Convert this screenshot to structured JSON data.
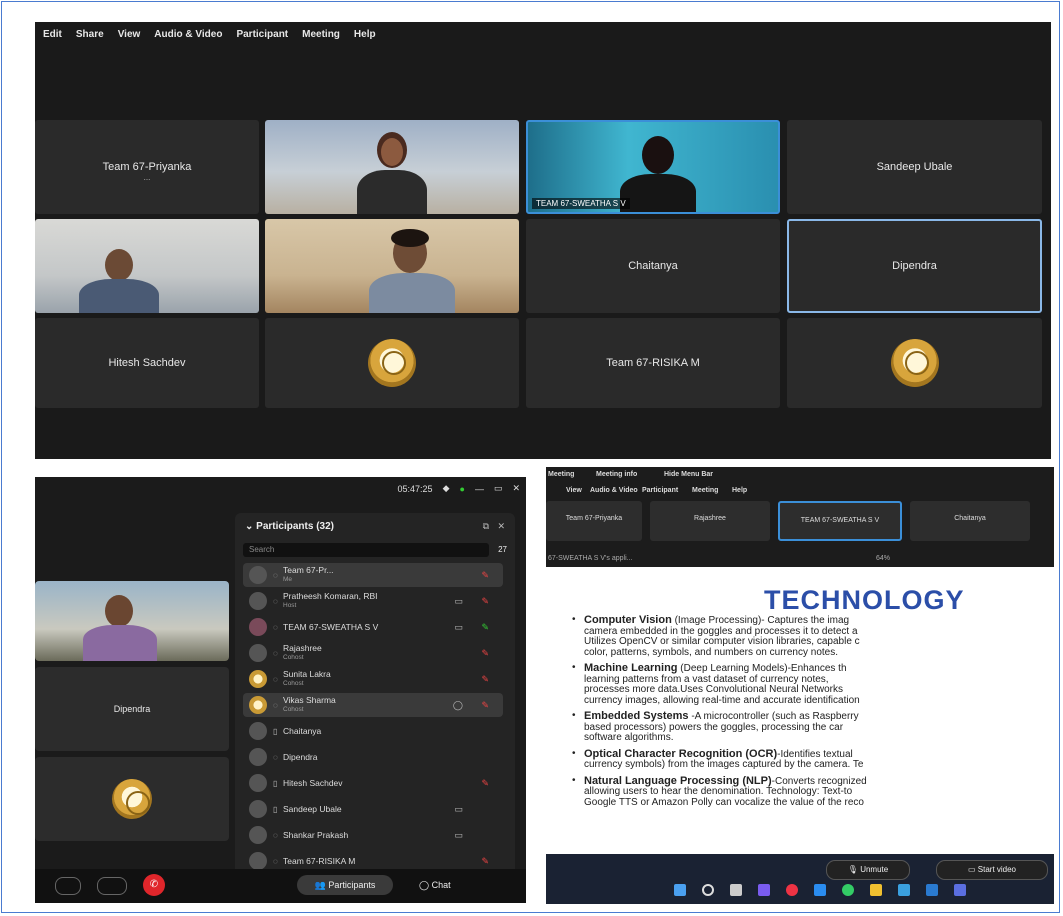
{
  "top": {
    "menu": [
      "Edit",
      "Share",
      "View",
      "Audio & Video",
      "Participant",
      "Meeting",
      "Help"
    ],
    "tiles": {
      "priyanka": {
        "name": "Team 67-Priyanka",
        "sub": "..."
      },
      "swatha": {
        "label": "TEAM 67-SWEATHA S V"
      },
      "sandeep": {
        "name": "Sandeep Ubale"
      },
      "chaitanya": {
        "name": "Chaitanya"
      },
      "dipendra": {
        "name": "Dipendra"
      },
      "hitesh": {
        "name": "Hitesh Sachdev"
      },
      "rishika": {
        "name": "Team 67-RISIKA M"
      }
    }
  },
  "bottom_left": {
    "time": "05:47:25",
    "panel_title": "Participants (32)",
    "search_placeholder": "Search",
    "count": "27",
    "participants": [
      {
        "name": "Team 67-Pr...",
        "sub": "Me"
      },
      {
        "name": "Pratheesh Komaran, RBI",
        "sub": "Host"
      },
      {
        "name": "TEAM 67-SWEATHA S V",
        "sub": ""
      },
      {
        "name": "Rajashree",
        "sub": "Cohost"
      },
      {
        "name": "Sunita Lakra",
        "sub": "Cohost"
      },
      {
        "name": "Vikas Sharma",
        "sub": "Cohost"
      },
      {
        "name": "Chaitanya",
        "sub": ""
      },
      {
        "name": "Dipendra",
        "sub": ""
      },
      {
        "name": "Hitesh Sachdev",
        "sub": ""
      },
      {
        "name": "Sandeep Ubale",
        "sub": ""
      },
      {
        "name": "Shankar Prakash",
        "sub": ""
      },
      {
        "name": "Team 67-RISIKA M",
        "sub": ""
      }
    ],
    "tile_name": "Dipendra",
    "participants_button": "Participants",
    "chat_button": "Chat"
  },
  "bottom_right": {
    "strip_menu": [
      "View",
      "Audio & Video",
      "Participant",
      "Meeting",
      "Help"
    ],
    "strip_top": [
      "Meeting",
      "Meeting info",
      "Hide Menu Bar"
    ],
    "strip_tiles": [
      "Team 67-Priyanka",
      "Rajashree",
      "TEAM 67-SWEATHA S V",
      "Chaitanya"
    ],
    "status": "67-SWEATHA S V's appli...",
    "zoom": "64%",
    "heading": "TECHNOLOGY",
    "bullets": [
      {
        "title": "Computer Vision",
        "line1": " (Image Processing)- Captures the imag",
        "line2": "camera embedded in the goggles and processes it to detect a",
        "line3": "Utilizes OpenCV or similar computer vision libraries, capable c",
        "line4": "color, patterns, symbols, and numbers on currency notes."
      },
      {
        "title": "Machine Learning",
        "line1": " (Deep Learning Models)-Enhances th",
        "line2": "learning patterns from a vast dataset of currency notes,",
        "line3": "processes more data.Uses Convolutional Neural Networks",
        "line4": "currency images, allowing real-time and accurate identification"
      },
      {
        "title": "Embedded Systems",
        "line1": " -A microcontroller (such as Raspberry",
        "line2": "based processors) powers the goggles, processing the car",
        "line3": "software algorithms.",
        "line4": ""
      },
      {
        "title": "Optical Character Recognition (OCR)",
        "line1": "-Identifies textual",
        "line2": "currency symbols) from the images captured by the camera. Te",
        "line3": "",
        "line4": ""
      },
      {
        "title": "Natural Language Processing (NLP)",
        "line1": "-Converts recognized",
        "line2": "allowing users to hear the denomination. Technology: Text-to",
        "line3": "Google TTS or Amazon Polly can vocalize the value of the reco",
        "line4": ""
      }
    ],
    "unmute": "Unmute",
    "start_video": "Start video"
  }
}
